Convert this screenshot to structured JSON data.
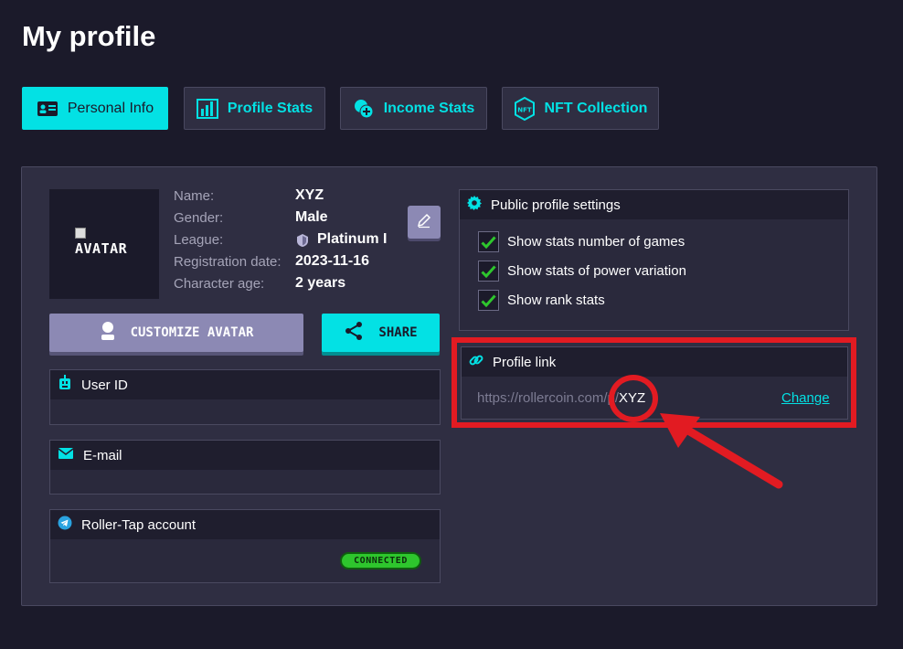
{
  "page": {
    "title": "My profile"
  },
  "tabs": [
    {
      "label": "Personal Info",
      "icon": "id-card-icon",
      "active": true
    },
    {
      "label": "Profile Stats",
      "icon": "bar-chart-icon",
      "active": false
    },
    {
      "label": "Income Stats",
      "icon": "coins-icon",
      "active": false
    },
    {
      "label": "NFT Collection",
      "icon": "nft-icon",
      "active": false
    }
  ],
  "profile": {
    "avatar_alt": "AVATAR",
    "fields": [
      {
        "label": "Name:",
        "value": "XYZ"
      },
      {
        "label": "Gender:",
        "value": "Male"
      },
      {
        "label": "League:",
        "value": "Platinum I"
      },
      {
        "label": "Registration date:",
        "value": "2023-11-16"
      },
      {
        "label": "Character age:",
        "value": "2 years"
      }
    ],
    "customize_label": "CUSTOMIZE AVATAR",
    "share_label": "SHARE"
  },
  "user_id": {
    "label": "User ID"
  },
  "email": {
    "label": "E-mail"
  },
  "roller_tap": {
    "label": "Roller-Tap account",
    "status": "CONNECTED"
  },
  "public_settings": {
    "title": "Public profile settings",
    "options": [
      {
        "label": "Show stats number of games",
        "checked": true
      },
      {
        "label": "Show stats of power variation",
        "checked": true
      },
      {
        "label": "Show rank stats",
        "checked": true
      }
    ]
  },
  "profile_link": {
    "title": "Profile link",
    "url_prefix": "https://rollercoin.com/p/",
    "handle": "XYZ",
    "change_label": "Change"
  },
  "colors": {
    "accent": "#03e1e4",
    "annotation": "#e21b22",
    "background": "#1b1a2a",
    "panel": "#2f2e42"
  }
}
